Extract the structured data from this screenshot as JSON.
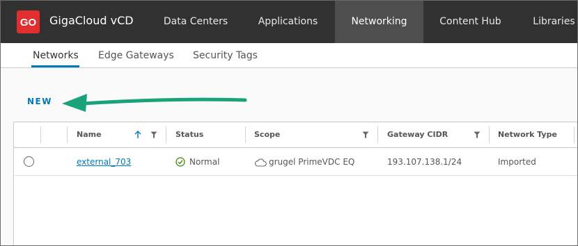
{
  "header": {
    "logo_text": "GO",
    "brand": "GigaCloud vCD",
    "nav": [
      {
        "label": "Data Centers"
      },
      {
        "label": "Applications"
      },
      {
        "label": "Networking"
      },
      {
        "label": "Content Hub"
      },
      {
        "label": "Libraries"
      }
    ],
    "active_nav": "Networking"
  },
  "subnav": {
    "tabs": [
      {
        "label": "Networks"
      },
      {
        "label": "Edge Gateways"
      },
      {
        "label": "Security Tags"
      }
    ],
    "active_tab": "Networks"
  },
  "toolbar": {
    "new_label": "NEW"
  },
  "grid": {
    "columns": [
      {
        "label": "Name",
        "sorted": "ascending",
        "filter": true
      },
      {
        "label": "Status",
        "filter": false
      },
      {
        "label": "Scope",
        "filter": true
      },
      {
        "label": "Gateway CIDR",
        "filter": true
      },
      {
        "label": "Network Type",
        "filter": false
      }
    ],
    "rows": [
      {
        "name": "external_703",
        "status": "Normal",
        "scope": "grugel PrimeVDC EQ",
        "gateway_cidr": "193.107.138.1/24",
        "network_type": "Imported"
      }
    ]
  },
  "colors": {
    "header_bg": "#313131",
    "active_nav_bg": "#4e4e4e",
    "logo_red": "#e12e2e",
    "accent_blue": "#0079b8",
    "annotation_arrow": "#1aa37a",
    "status_ok": "#2f8400"
  },
  "icons": {
    "logo": "giga-cloud-logo-icon",
    "sort": "arrow-up-icon",
    "filter": "filter-icon",
    "status": "check-circle-icon",
    "scope": "cloud-icon",
    "arrow": "annotation-arrow-icon"
  }
}
